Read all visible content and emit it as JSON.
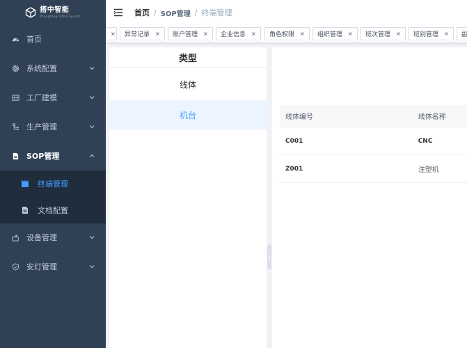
{
  "logo": {
    "name": "搭中智能",
    "sub": "Zhonghang Intelli Sys Ltd"
  },
  "sidebar": {
    "items": [
      {
        "label": "首页"
      },
      {
        "label": "系统配置"
      },
      {
        "label": "工厂建模"
      },
      {
        "label": "生产管理"
      },
      {
        "label": "SOP管理"
      },
      {
        "label": "设备管理"
      },
      {
        "label": "安灯管理"
      }
    ],
    "sop_sub": [
      {
        "label": "终端管理"
      },
      {
        "label": "文档配置"
      }
    ]
  },
  "breadcrumb": {
    "home": "首页",
    "sep1": "/",
    "mid": "SOP管理",
    "sep2": "/",
    "current": "终端管理"
  },
  "tags": [
    {
      "label": ""
    },
    {
      "label": "异常记录"
    },
    {
      "label": "账户管理"
    },
    {
      "label": "企业信息"
    },
    {
      "label": "角色权限"
    },
    {
      "label": "组织管理"
    },
    {
      "label": "班次管理"
    },
    {
      "label": "班别管理"
    },
    {
      "label": "副"
    }
  ],
  "tag_close": "×",
  "type_panel": {
    "title": "类型",
    "items": [
      {
        "label": "线体"
      },
      {
        "label": "机台"
      }
    ]
  },
  "table": {
    "headers": {
      "code": "线体编号",
      "name": "线体名称"
    },
    "rows": [
      {
        "code": "C001",
        "name": "CNC"
      },
      {
        "code": "Z001",
        "name": "注塑机"
      }
    ]
  },
  "colors": {
    "sidebar": "#304156",
    "submenu": "#1f2d3d",
    "accent": "#409eff"
  }
}
